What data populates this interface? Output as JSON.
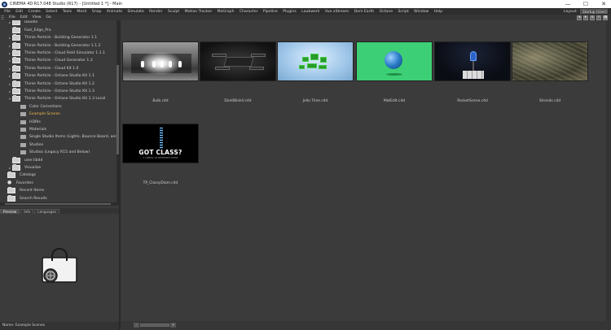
{
  "window": {
    "title": "CINEMA 4D R17.048 Studio (R17) - [Untitled 1 *] - Main",
    "controls": [
      "—",
      "☐",
      "✕"
    ]
  },
  "menu": [
    "File",
    "Edit",
    "Create",
    "Select",
    "Tools",
    "Mesh",
    "Snap",
    "Animate",
    "Simulate",
    "Render",
    "Sculpt",
    "Motion Tracker",
    "MoGraph",
    "Character",
    "Pipeline",
    "Plugins",
    "Laubwerk",
    "Vue xStream",
    "Dem Earth",
    "Octane",
    "Script",
    "Window",
    "Help"
  ],
  "layout": {
    "label": "Layout:",
    "value": "Startup (User)"
  },
  "browser_menu": [
    "File",
    "Edit",
    "View",
    "Go"
  ],
  "tree": [
    {
      "label": "Doodle",
      "indent": 0,
      "expander": "▸",
      "folder": "light"
    },
    {
      "label": "Fast_Edge_Pro",
      "indent": 0,
      "expander": "",
      "folder": "light"
    },
    {
      "label": "Thinie Particle - Building Generator 1.1",
      "indent": 0,
      "expander": "▸",
      "folder": "light"
    },
    {
      "label": "Thinie Particle - Building Generator 1.1.2",
      "indent": 0,
      "expander": "▸",
      "folder": "light"
    },
    {
      "label": "Thinie Particle - Cloud Field Simulator 1.1.1",
      "indent": 0,
      "expander": "▸",
      "folder": "light"
    },
    {
      "label": "Thinie Particle - Cloud Generator 1.3",
      "indent": 0,
      "expander": "▸",
      "folder": "light"
    },
    {
      "label": "Thinie Particle - Cloud Kit 1.0",
      "indent": 0,
      "expander": "▸",
      "folder": "light"
    },
    {
      "label": "Thinie Particle - Octane Studio Kit 1.1",
      "indent": 0,
      "expander": "▸",
      "folder": "light"
    },
    {
      "label": "Thinie Particle - Octane Studio Kit 1.2",
      "indent": 0,
      "expander": "▸",
      "folder": "light"
    },
    {
      "label": "Thinie Particle - Octane Studio Kit 1.3",
      "indent": 0,
      "expander": "▸",
      "folder": "light"
    },
    {
      "label": "Thinie Particle - Octane Studio Kit 1.3 Local",
      "indent": 0,
      "expander": "▾",
      "folder": "light"
    },
    {
      "label": "Color Corrections",
      "indent": 1,
      "expander": "",
      "folder": "small"
    },
    {
      "label": "Example Scenes",
      "indent": 1,
      "expander": "",
      "folder": "small",
      "selected": true
    },
    {
      "label": "HDRIs",
      "indent": 1,
      "expander": "",
      "folder": "small"
    },
    {
      "label": "Materials",
      "indent": 1,
      "expander": "",
      "folder": "small"
    },
    {
      "label": "Single Studio Items (Lights, Bounce Board, and Studio",
      "indent": 1,
      "expander": "",
      "folder": "small"
    },
    {
      "label": "Studios",
      "indent": 1,
      "expander": "",
      "folder": "small"
    },
    {
      "label": "Studios (Legacy R15 and Below)",
      "indent": 1,
      "expander": "",
      "folder": "small"
    },
    {
      "label": "user.lib4d",
      "indent": 0,
      "expander": "",
      "folder": "light"
    },
    {
      "label": "Visualize",
      "indent": 0,
      "expander": "▸",
      "folder": "light"
    },
    {
      "label": "Catalogs",
      "indent": -1,
      "expander": "",
      "folder": "light"
    },
    {
      "label": "Favorites",
      "indent": -1,
      "expander": "",
      "folder": "star"
    },
    {
      "label": "Recent Items",
      "indent": -1,
      "expander": "",
      "folder": "light"
    },
    {
      "label": "Search Results",
      "indent": -1,
      "expander": "",
      "folder": "light"
    }
  ],
  "preview_tabs": [
    "Preview",
    "Info",
    "Languages"
  ],
  "status": "Name: Example Scenes",
  "files": [
    {
      "name": "Bulb.c4d",
      "art": "bulb"
    },
    {
      "name": "DontBlinkV.c4d",
      "art": "drone"
    },
    {
      "name": "Jello Time.c4d",
      "art": "grass"
    },
    {
      "name": "MatEdit.c4d",
      "art": "matedit"
    },
    {
      "name": "RocketScene.c4d",
      "art": "rocket"
    },
    {
      "name": "Strands.c4d",
      "art": "strands"
    },
    {
      "name": "TP_ClassyDiam.c4d",
      "art": "class"
    }
  ],
  "got_class": {
    "title": "GOT CLASS?",
    "subtitle": "A CINEMA 4D REFERENCE SCENE"
  },
  "zoom": {
    "minus": "–",
    "plus": "+"
  }
}
